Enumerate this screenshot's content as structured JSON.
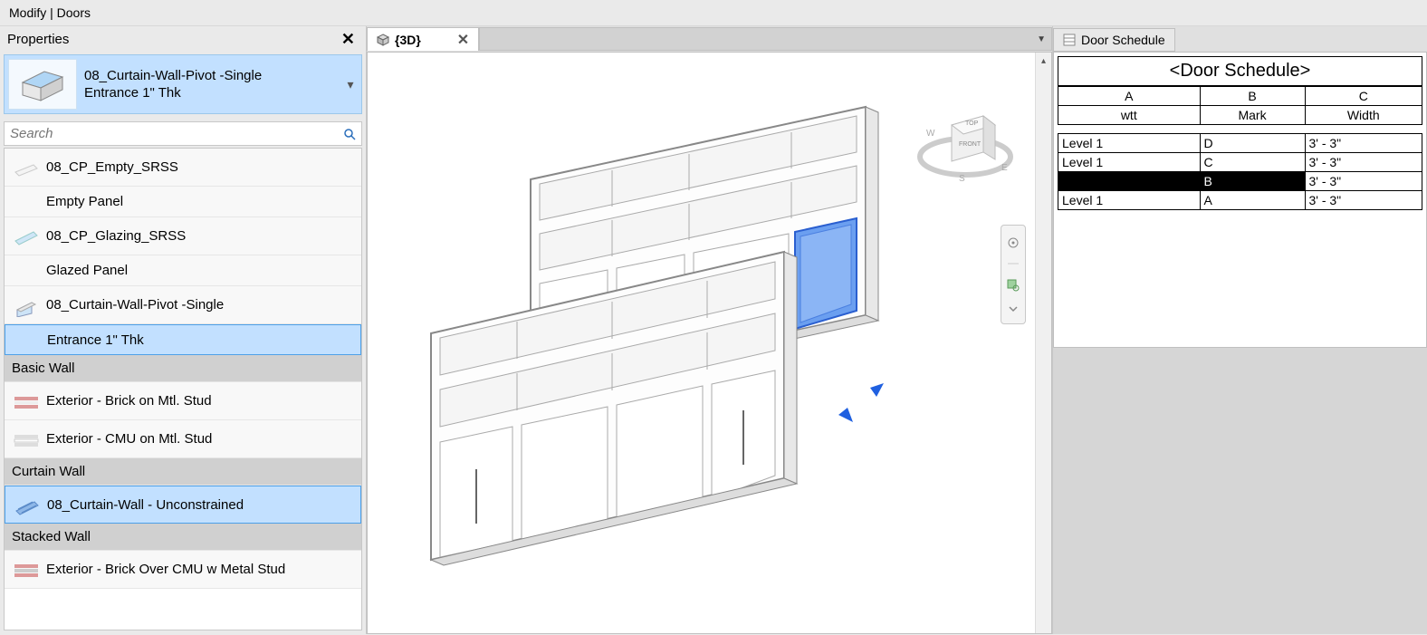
{
  "title": "Modify | Doors",
  "properties": {
    "header": "Properties",
    "type_name": "08_Curtain-Wall-Pivot -Single",
    "type_sub": "Entrance 1\" Thk",
    "search_placeholder": "Search"
  },
  "type_list": [
    {
      "kind": "item",
      "label": "08_CP_Empty_SRSS",
      "icon": "blank"
    },
    {
      "kind": "sub",
      "label": "Empty Panel"
    },
    {
      "kind": "item",
      "label": "08_CP_Glazing_SRSS",
      "icon": "glass"
    },
    {
      "kind": "sub",
      "label": "Glazed Panel"
    },
    {
      "kind": "item",
      "label": "08_Curtain-Wall-Pivot -Single",
      "icon": "door"
    },
    {
      "kind": "sub",
      "label": "Entrance 1\" Thk",
      "selected": true
    },
    {
      "kind": "group",
      "label": "Basic Wall"
    },
    {
      "kind": "item",
      "label": "Exterior - Brick on Mtl. Stud",
      "icon": "brick"
    },
    {
      "kind": "item",
      "label": "Exterior - CMU on Mtl. Stud",
      "icon": "cmu"
    },
    {
      "kind": "group",
      "label": "Curtain Wall"
    },
    {
      "kind": "item",
      "label": "08_Curtain-Wall - Unconstrained",
      "icon": "curtain",
      "selected_border": true
    },
    {
      "kind": "group",
      "label": "Stacked Wall"
    },
    {
      "kind": "item",
      "label": "Exterior - Brick Over CMU w Metal Stud",
      "icon": "stack"
    }
  ],
  "view_tab": {
    "label": "{3D}"
  },
  "schedule": {
    "tab_label": "Door Schedule",
    "title": "<Door Schedule>",
    "cols": [
      "A",
      "B",
      "C"
    ],
    "colnames": [
      "wtt",
      "Mark",
      "Width"
    ],
    "rows": [
      {
        "cells": [
          "Level 1",
          "D",
          "3' - 3\""
        ]
      },
      {
        "cells": [
          "Level 1",
          "C",
          "3' - 3\""
        ]
      },
      {
        "cells": [
          "",
          "B",
          "3' - 3\""
        ],
        "selected": true
      },
      {
        "cells": [
          "Level 1",
          "A",
          "3' - 3\""
        ]
      }
    ]
  },
  "navcube": {
    "top": "TOP",
    "front": "FRONT",
    "w": "W",
    "e": "E",
    "s": "S"
  }
}
